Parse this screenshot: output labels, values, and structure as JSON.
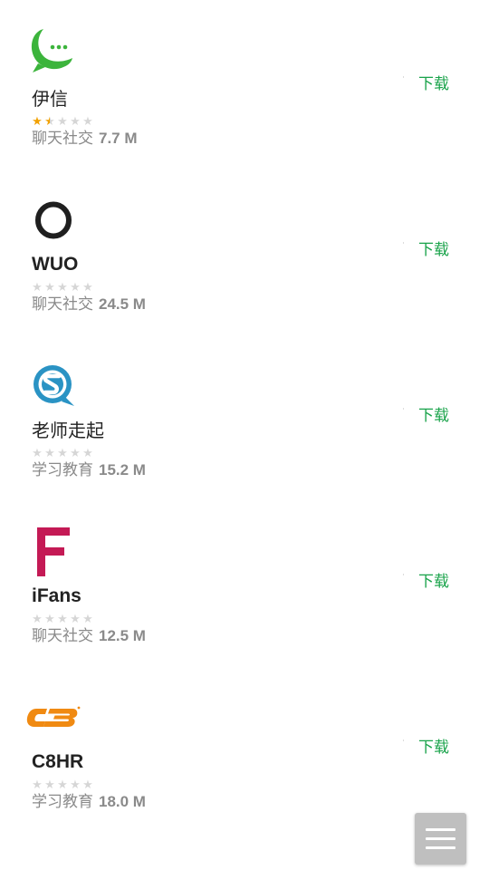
{
  "colors": {
    "accent": "#19a34a",
    "star_filled": "#f2a100",
    "star_empty": "#d6d6d6",
    "meta_text": "#8a8a8a"
  },
  "apps": [
    {
      "name": "伊信",
      "rating": 1.5,
      "category": "聊天社交",
      "size": "7.7 M",
      "download_label": "下载",
      "icon": "yixin-chat-bubble-icon"
    },
    {
      "name": "WUO",
      "rating": 0,
      "category": "聊天社交",
      "size": "24.5 M",
      "download_label": "下载",
      "icon": "wuo-ring-icon"
    },
    {
      "name": "老师走起",
      "rating": 0,
      "category": "学习教育",
      "size": "15.2 M",
      "download_label": "下载",
      "icon": "laoshi-zouqi-s-bubble-icon"
    },
    {
      "name": "iFans",
      "rating": 0,
      "category": "聊天社交",
      "size": "12.5 M",
      "download_label": "下载",
      "icon": "ifans-letter-f-icon"
    },
    {
      "name": "C8HR",
      "rating": 0,
      "category": "学习教育",
      "size": "18.0 M",
      "download_label": "下载",
      "icon": "c8hr-logo-icon"
    }
  ],
  "fab": {
    "icon": "hamburger-menu-icon"
  }
}
